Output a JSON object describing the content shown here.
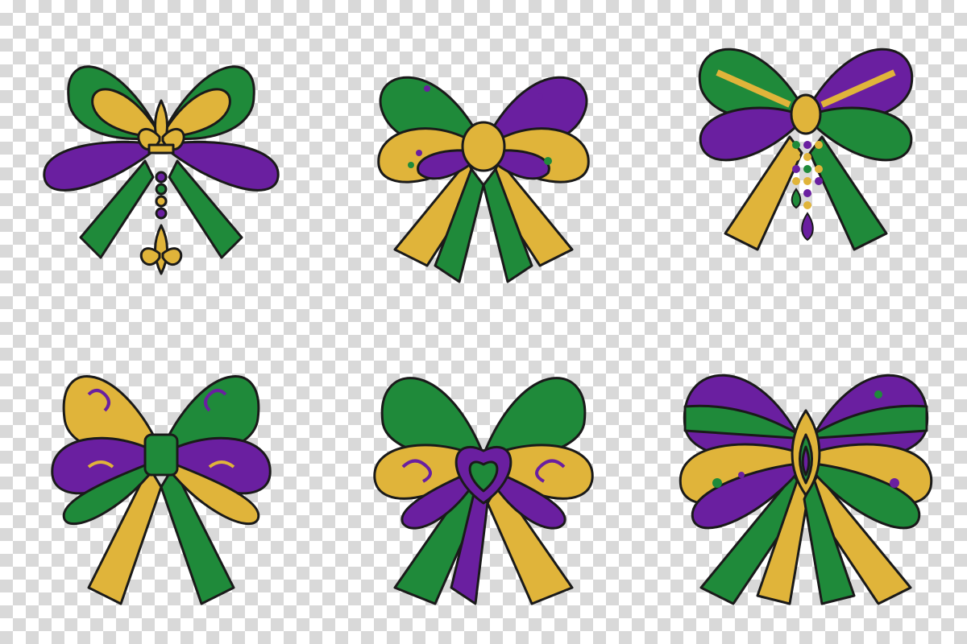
{
  "colors": {
    "purple": "#6a1fa0",
    "purple_dark": "#3d0b63",
    "green": "#1f8a3a",
    "green_dark": "#0c4d1e",
    "gold": "#e0b43a",
    "gold_dark": "#9a6d12",
    "outline": "#1a1a1a"
  },
  "bows": [
    {
      "name": "bow-fleur-de-lis-pendant",
      "style": "fleur-de-lis center with bead drop and fleur-de-lis charm"
    },
    {
      "name": "bow-gold-knot",
      "style": "green/purple/gold loops with gold oval knot"
    },
    {
      "name": "bow-bead-strands",
      "style": "striped bow with hanging bead strands"
    },
    {
      "name": "bow-swirl-pattern",
      "style": "gold and purple loops with swirl designs"
    },
    {
      "name": "bow-heart-center",
      "style": "heart centerpiece with green and purple loops"
    },
    {
      "name": "bow-jester-center",
      "style": "wide striped bow with jester crest center"
    }
  ]
}
